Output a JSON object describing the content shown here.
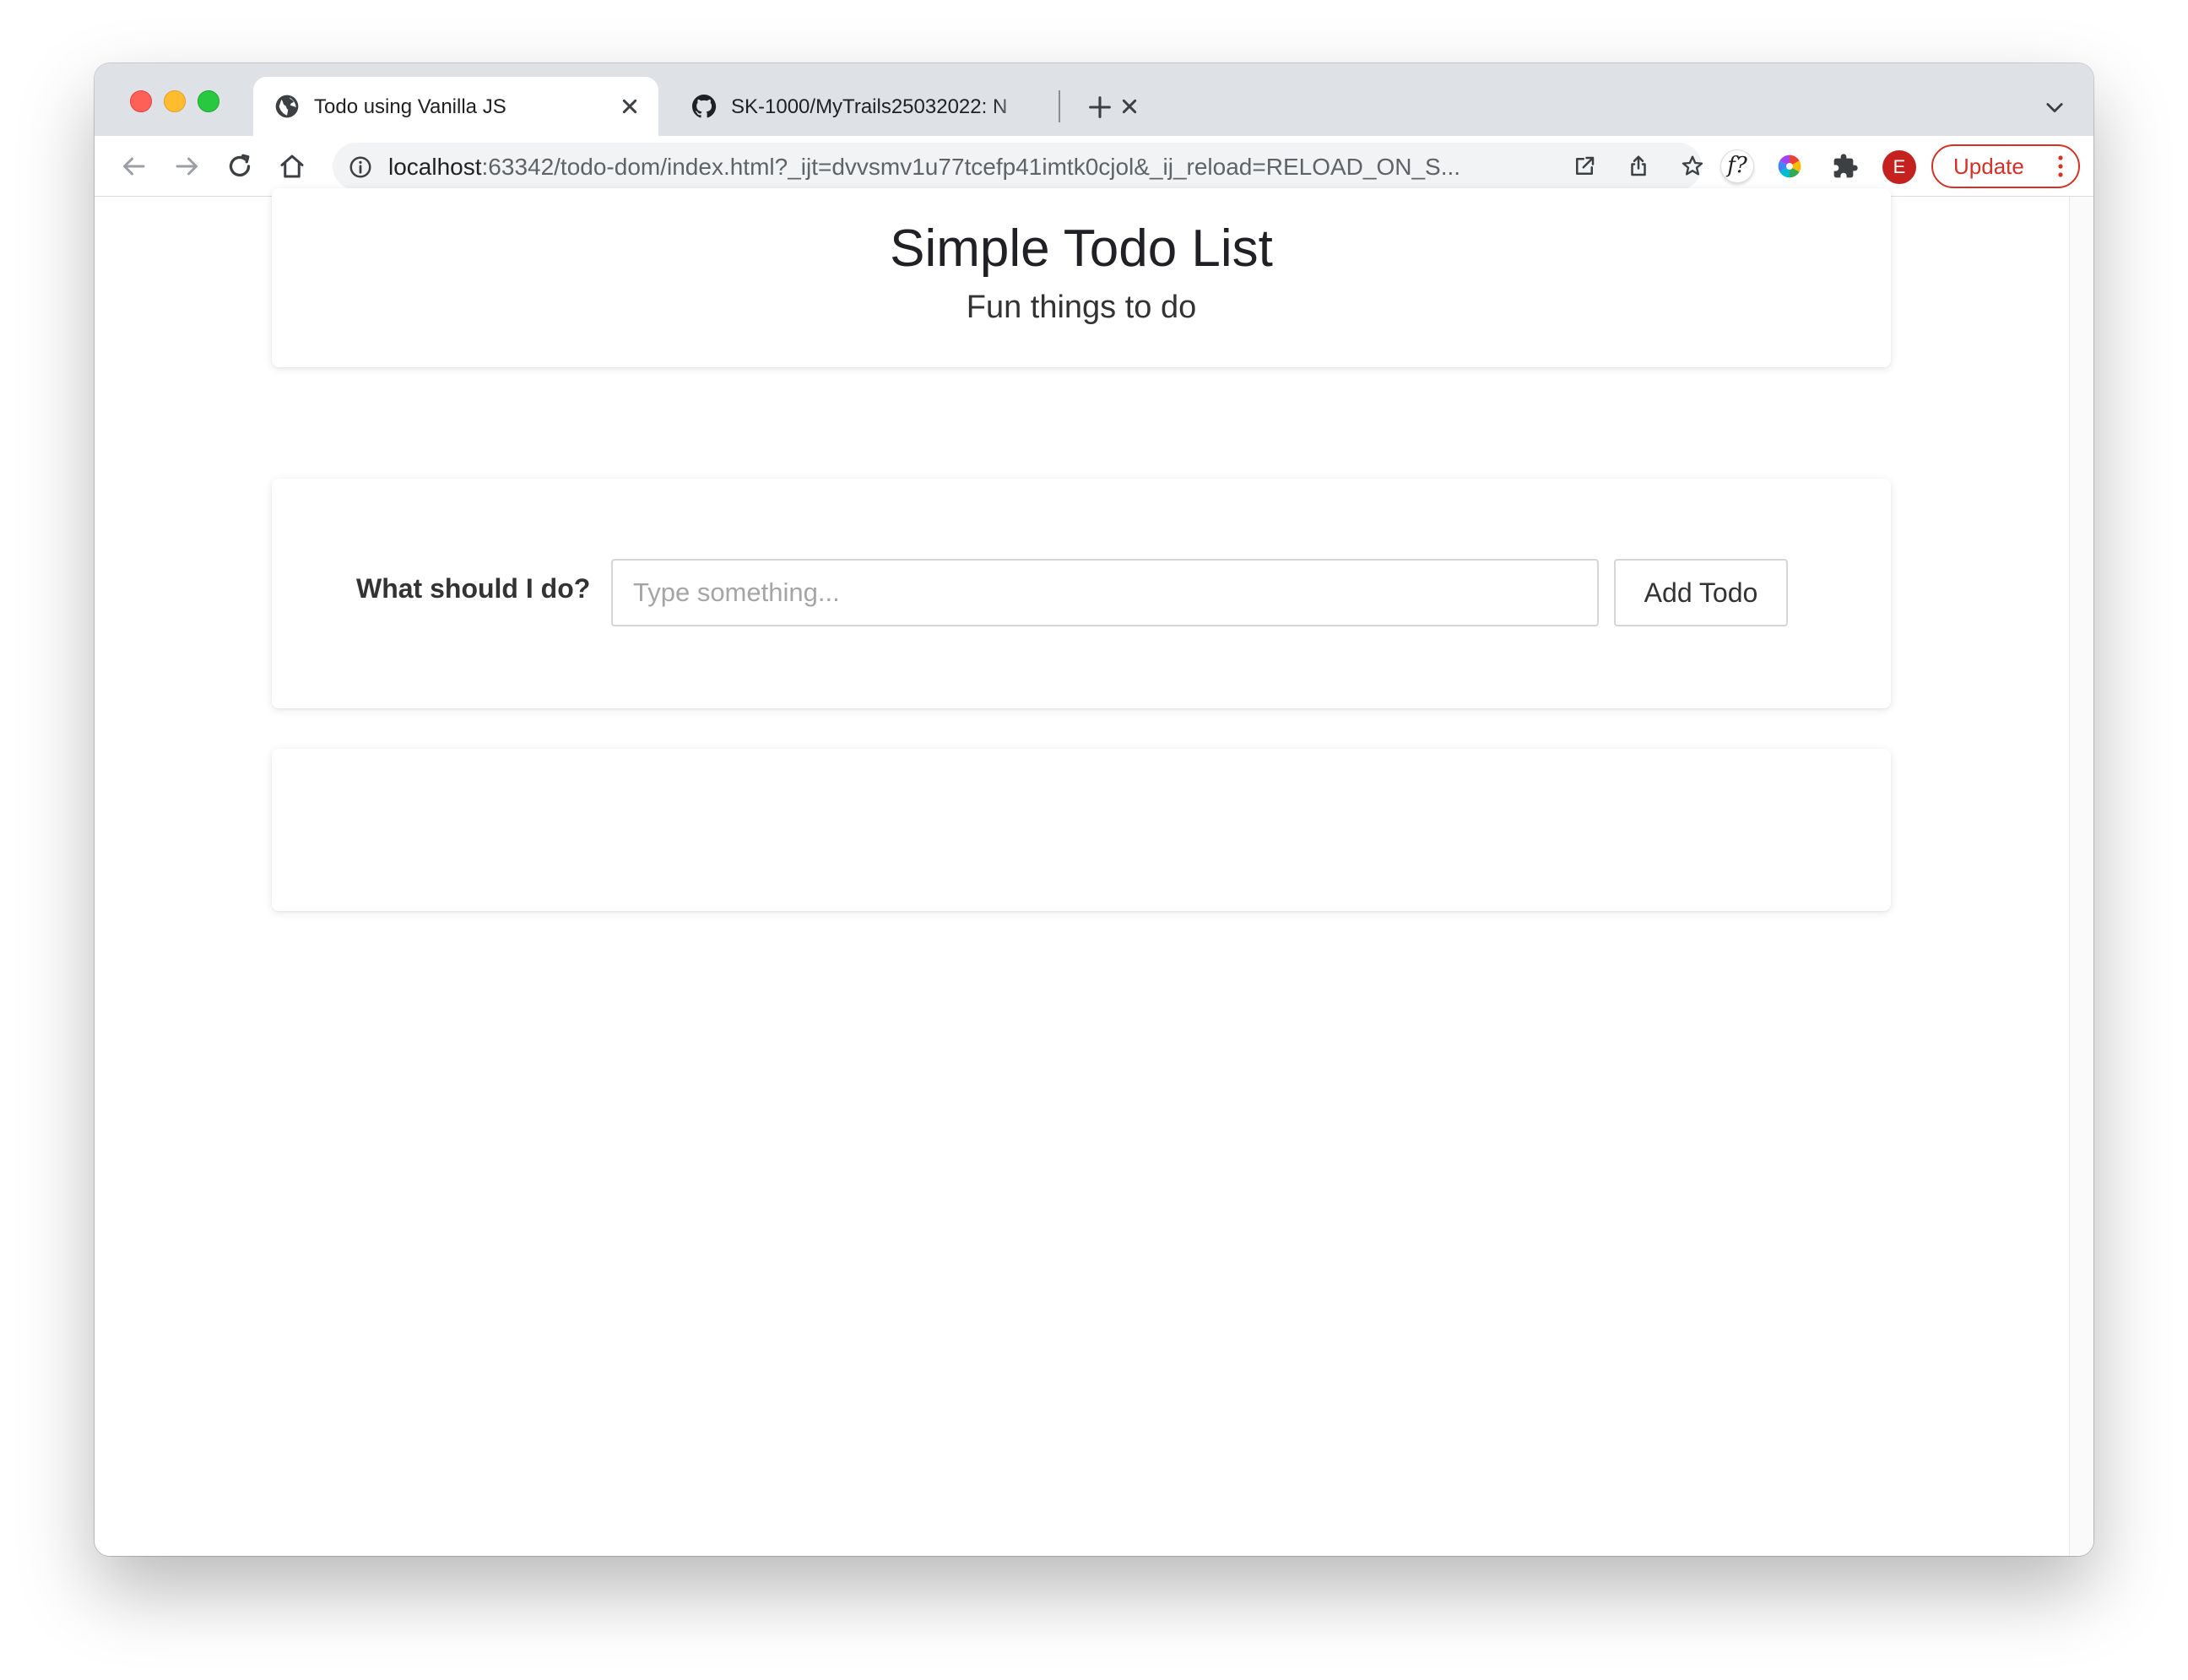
{
  "browser": {
    "tabs": [
      {
        "title": "Todo using Vanilla JS",
        "active": true,
        "favicon": "globe-icon"
      },
      {
        "title": "SK-1000/MyTrails25032022: N",
        "active": false,
        "favicon": "github-icon"
      }
    ],
    "url_host": "localhost",
    "url_rest": ":63342/todo-dom/index.html?_ijt=dvvsmv1u77tcefp41imtk0cjol&_ij_reload=RELOAD_ON_S...",
    "extension_f_label": "f?",
    "avatar_initial": "E",
    "update_label": "Update",
    "accent_update": "#d93025",
    "avatar_color": "#c5221f"
  },
  "page": {
    "title": "Simple Todo List",
    "subtitle": "Fun things to do",
    "form": {
      "label": "What should I do?",
      "input_placeholder": "Type something...",
      "input_value": "",
      "button_label": "Add Todo"
    },
    "todos": []
  }
}
